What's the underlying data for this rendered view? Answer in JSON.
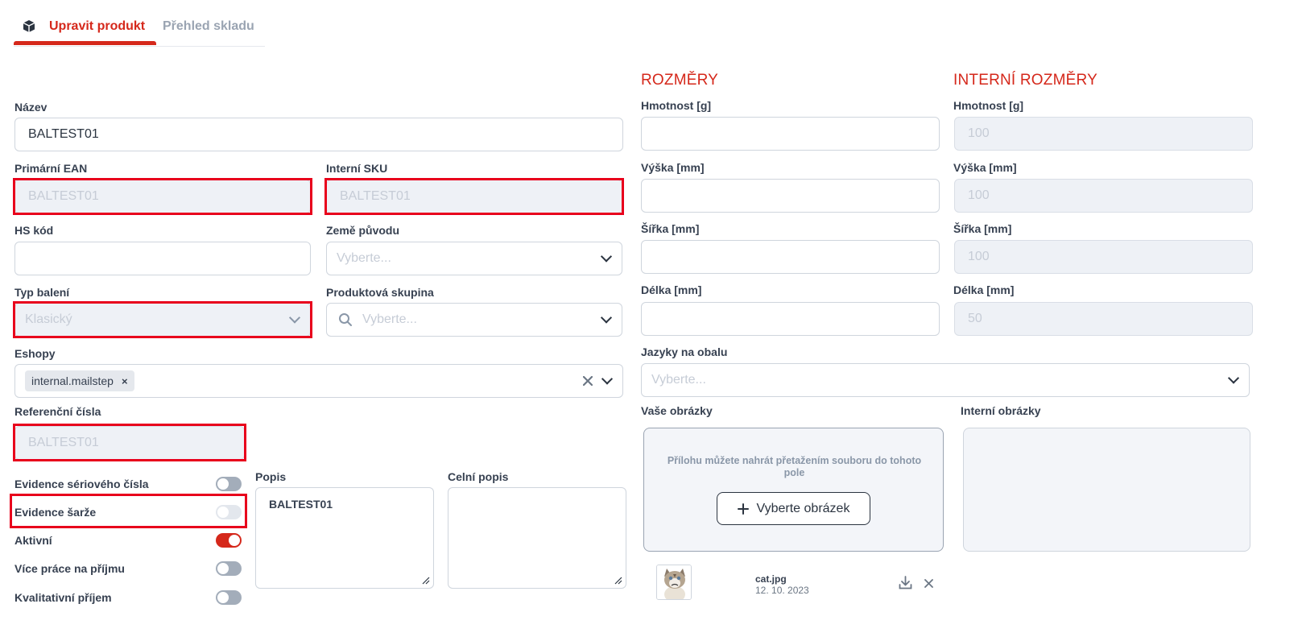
{
  "tabs": [
    {
      "label": "Upravit produkt",
      "active": true
    },
    {
      "label": "Přehled skladu",
      "active": false
    }
  ],
  "colors": {
    "accent": "#d5281b",
    "highlight": "#e8001c"
  },
  "form": {
    "name": {
      "label": "Název",
      "value": "BALTEST01"
    },
    "ean": {
      "label": "Primární EAN",
      "value": "BALTEST01"
    },
    "sku": {
      "label": "Interní SKU",
      "value": "BALTEST01"
    },
    "hs": {
      "label": "HS kód",
      "value": ""
    },
    "origin": {
      "label": "Země původu",
      "placeholder": "Vyberte..."
    },
    "packaging": {
      "label": "Typ balení",
      "value": "Klasický"
    },
    "group": {
      "label": "Produktová skupina",
      "placeholder": "Vyberte..."
    },
    "eshops": {
      "label": "Eshopy",
      "tags": [
        "internal.mailstep"
      ],
      "tag_remove": "×"
    },
    "reference": {
      "label": "Referenční čísla",
      "value": "BALTEST01"
    }
  },
  "toggles": [
    {
      "label": "Evidence sériového čísla",
      "on": false
    },
    {
      "label": "Evidence šarže",
      "on": false
    },
    {
      "label": "Aktivní",
      "on": true
    },
    {
      "label": "Více práce na příjmu",
      "on": false
    },
    {
      "label": "Kvalitativní příjem",
      "on": false
    }
  ],
  "description": {
    "label": "Popis",
    "value": "BALTEST01"
  },
  "customs_description": {
    "label": "Celní popis",
    "value": ""
  },
  "dimensions": {
    "title": "ROZMĚRY",
    "weight_label": "Hmotnost [g]",
    "height_label": "Výška [mm]",
    "width_label": "Šířka [mm]",
    "length_label": "Délka [mm]"
  },
  "internal_dimensions": {
    "title": "INTERNÍ ROZMĚRY",
    "weight_label": "Hmotnost [g]",
    "weight": "100",
    "height_label": "Výška [mm]",
    "height": "100",
    "width_label": "Šířka [mm]",
    "width": "100",
    "length_label": "Délka [mm]",
    "length": "50"
  },
  "languages": {
    "label": "Jazyky na obalu",
    "placeholder": "Vyberte..."
  },
  "images": {
    "yours_label": "Vaše obrázky",
    "internal_label": "Interní obrázky",
    "drop_hint": "Přílohu můžete nahrát přetažením souboru do tohoto pole",
    "select_button": "Vyberte obrázek",
    "file": {
      "name": "cat.jpg",
      "date": "12. 10. 2023"
    }
  }
}
